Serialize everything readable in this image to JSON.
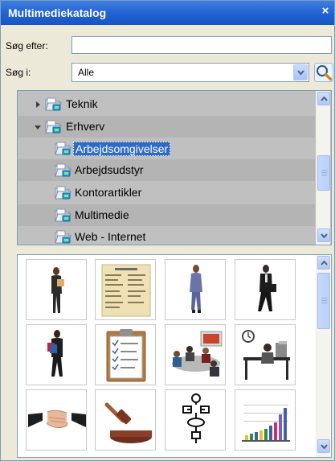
{
  "window": {
    "title": "Multimediekatalog",
    "close_glyph": "×"
  },
  "search": {
    "label": "Søg efter:",
    "value": "",
    "placeholder": ""
  },
  "search_in": {
    "label": "Søg i:",
    "selected": "Alle"
  },
  "tree": {
    "items": [
      {
        "label": "Teknik",
        "expander": "collapsed",
        "selected": false
      },
      {
        "label": "Erhverv",
        "expander": "expanded",
        "selected": false
      },
      {
        "label": "Arbejdsomgivelser",
        "expander": "none",
        "selected": true
      },
      {
        "label": "Arbejdsudstyr",
        "expander": "none",
        "selected": false
      },
      {
        "label": "Kontorartikler",
        "expander": "none",
        "selected": false
      },
      {
        "label": "Multimedie",
        "expander": "none",
        "selected": false
      },
      {
        "label": "Web - Internet",
        "expander": "none",
        "selected": false
      }
    ]
  },
  "clips": [
    {
      "subject": "woman-reading-clip"
    },
    {
      "subject": "document-form-clip"
    },
    {
      "subject": "businesswoman-walking-clip"
    },
    {
      "subject": "businessman-walking-clip"
    },
    {
      "subject": "woman-holding-folders-clip"
    },
    {
      "subject": "clipboard-checklist-clip"
    },
    {
      "subject": "business-meeting-clip"
    },
    {
      "subject": "man-at-desk-clip"
    },
    {
      "subject": "handshake-clip"
    },
    {
      "subject": "gavel-clip"
    },
    {
      "subject": "flowchart-clip"
    },
    {
      "subject": "bar-chart-clip"
    }
  ],
  "colors": {
    "title_bar": "#1f5fd0",
    "selection": "#316ac5",
    "tree_bg": "#c0c0c0"
  }
}
